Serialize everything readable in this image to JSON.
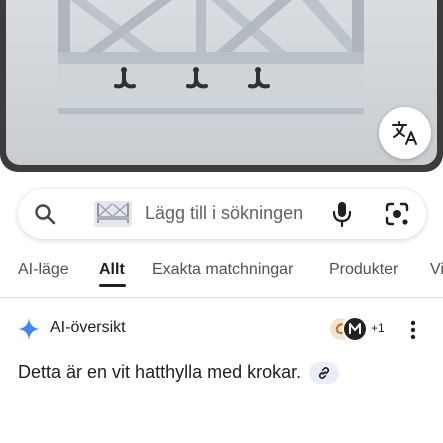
{
  "search": {
    "placeholder": "Lägg till i sökningen"
  },
  "tabs": [
    {
      "label": "AI-läge"
    },
    {
      "label": "Allt"
    },
    {
      "label": "Exakta matchningar"
    },
    {
      "label": "Produkter"
    },
    {
      "label": "Vi"
    }
  ],
  "ai_overview": {
    "title": "AI-översikt",
    "avatar_count": "+1",
    "text": "Detta är en vit hatthylla med krokar."
  },
  "icons": {
    "translate": "translate-icon",
    "search": "search-icon",
    "mic": "mic-icon",
    "lens": "lens-icon",
    "spark": "gemini-spark-icon",
    "more": "more-vert-icon",
    "link": "link-icon"
  },
  "colors": {
    "spark_blue": "#4285f4",
    "chip_bg": "#e8edf7"
  }
}
